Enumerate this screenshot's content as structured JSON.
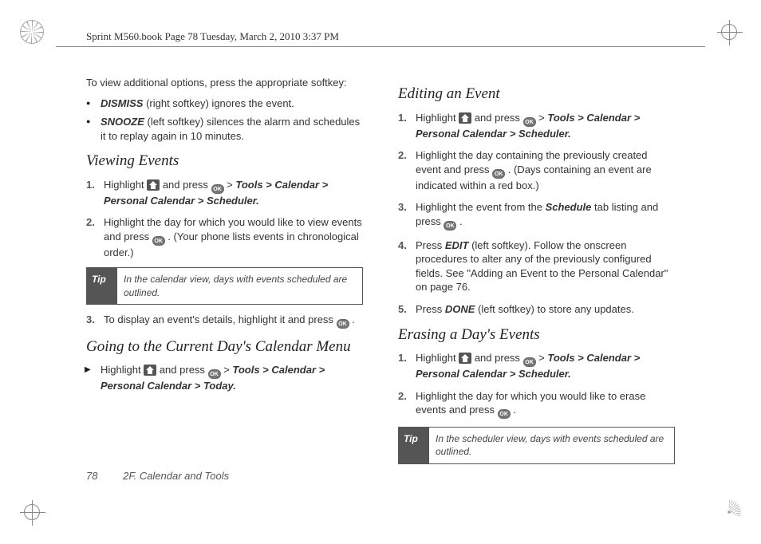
{
  "meta": {
    "header": "Sprint M560.book  Page 78  Tuesday, March 2, 2010  3:37 PM"
  },
  "left": {
    "intro": "To view additional options, press the appropriate softkey:",
    "bullets": [
      {
        "head": "DISMISS",
        "tail": " (right softkey) ignores the event."
      },
      {
        "head": "SNOOZE",
        "tail": " (left softkey) silences the alarm and schedules it to replay again in 10 minutes."
      }
    ],
    "h_viewing": "Viewing Events",
    "ve1_a": "Highlight ",
    "ve1_b": " and press ",
    "ve1_c": " > ",
    "path": "Tools > Calendar > Personal Calendar > Scheduler.",
    "ve2_a": "Highlight the day for which you would like to view events and press ",
    "ve2_b": ". (Your phone lists events in chronological order.)",
    "tip_lab": "Tip",
    "tip1": "In the calendar view, days with events scheduled are outlined.",
    "ve3_a": "To display an event's details, highlight it and press ",
    "ve3_b": ".",
    "h_today": "Going to the Current Day's Calendar Menu",
    "td_a": "Highlight ",
    "td_b": " and press ",
    "td_c": " > ",
    "path_today": "Tools > Calendar > Personal Calendar > Today."
  },
  "right": {
    "h_edit": "Editing an Event",
    "ee1_a": "Highlight ",
    "ee1_b": " and press ",
    "ee1_c": " > ",
    "path": "Tools > Calendar > Personal Calendar > Scheduler.",
    "ee2_a": "Highlight the day containing the previously created event and press ",
    "ee2_b": ". (Days containing an event are indicated within a red box.)",
    "ee3_a": "Highlight the event from the ",
    "ee3_tab": "Schedule",
    "ee3_b": " tab listing and press ",
    "ee3_c": ".",
    "ee4_a": "Press ",
    "ee4_edit": "EDIT",
    "ee4_b": " (left softkey). Follow the onscreen procedures to alter any of the previously configured fields. See \"Adding an Event to the Personal Calendar\" on page 76.",
    "ee5_a": "Press ",
    "ee5_done": "DONE",
    "ee5_b": " (left softkey) to store any updates.",
    "h_erase": "Erasing a Day's Events",
    "er1_a": "Highlight ",
    "er1_b": " and press ",
    "er1_c": " > ",
    "er2_a": "Highlight the day for which you would like to erase events and press ",
    "er2_b": ".",
    "tip_lab": "Tip",
    "tip2": "In the scheduler view, days with events scheduled are outlined."
  },
  "footer": {
    "page": "78",
    "section": "2F. Calendar and Tools"
  }
}
